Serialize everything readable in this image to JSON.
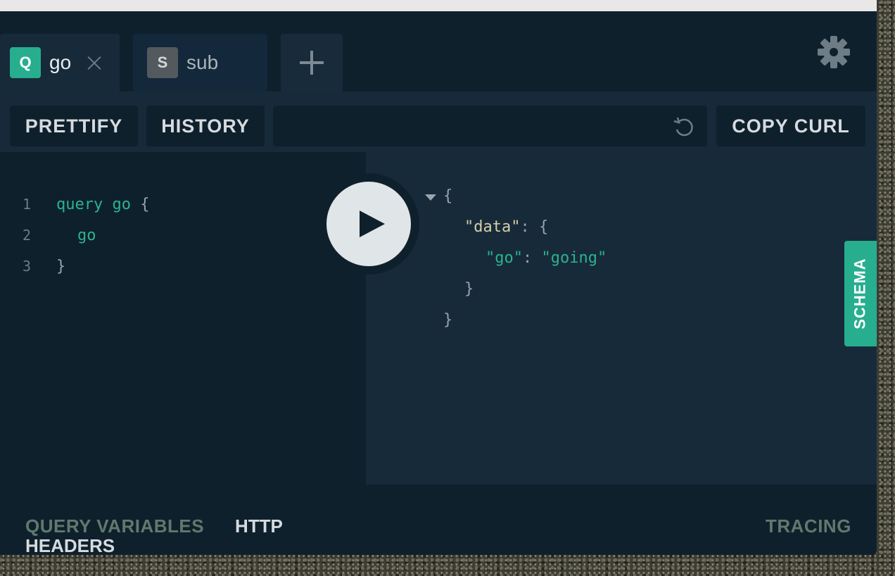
{
  "tabs": [
    {
      "badge": "Q",
      "label": "go"
    },
    {
      "badge": "S",
      "label": "sub"
    }
  ],
  "toolbar": {
    "prettify": "PRETTIFY",
    "history": "HISTORY",
    "url_value": "",
    "copy_curl": "COPY CURL"
  },
  "editor": {
    "lines": [
      {
        "num": "1",
        "kw": "query",
        "name": "go",
        "brace": "{"
      },
      {
        "num": "2",
        "field": "go"
      },
      {
        "num": "3",
        "brace": "}"
      }
    ]
  },
  "result": {
    "open": "{",
    "data_key": "\"data\"",
    "colon": ":",
    "inner_open": "{",
    "go_key": "\"go\"",
    "go_value": "\"going\"",
    "inner_close": "}",
    "close": "}"
  },
  "schema_label": "SCHEMA",
  "bottom": {
    "query_variables": "QUERY VARIABLES",
    "http": "HTTP",
    "headers": "HEADERS",
    "tracing": "TRACING"
  },
  "colors": {
    "accent": "#27ae8e",
    "panel_dark": "#0f202d",
    "panel": "#172a3a"
  },
  "icons": [
    "close-icon",
    "plus-icon",
    "gear-icon",
    "reload-icon",
    "play-icon",
    "fold-icon"
  ]
}
